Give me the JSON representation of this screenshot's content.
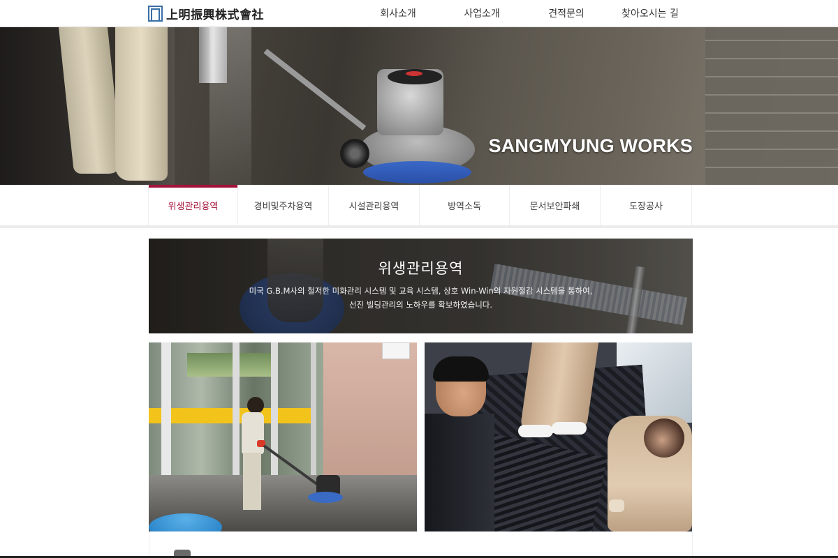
{
  "header": {
    "logo_text": "上明振興株式會社",
    "nav": [
      {
        "label": "회사소개"
      },
      {
        "label": "사업소개"
      },
      {
        "label": "견적문의"
      },
      {
        "label": "찾아오시는 길"
      }
    ]
  },
  "hero": {
    "title": "SANGMYUNG WORKS"
  },
  "subnav": {
    "tabs": [
      {
        "label": "위생관리용역",
        "active": true
      },
      {
        "label": "경비및주차용역",
        "active": false
      },
      {
        "label": "시설관리용역",
        "active": false
      },
      {
        "label": "방역소독",
        "active": false
      },
      {
        "label": "문서보안파쇄",
        "active": false
      },
      {
        "label": "도장공사",
        "active": false
      }
    ]
  },
  "banner": {
    "title": "위생관리용역",
    "desc_line1": "미국 G.B.M사의 철저한 미화관리 시스템 및 교육 시스템, 상호 Win-Win의 자원절감 시스템을 통하여,",
    "desc_line2": "선진 빌딩관리의 노하우를 확보하였습니다."
  },
  "colors": {
    "accent": "#a3123a",
    "logo_blue": "#3a6fa6"
  }
}
